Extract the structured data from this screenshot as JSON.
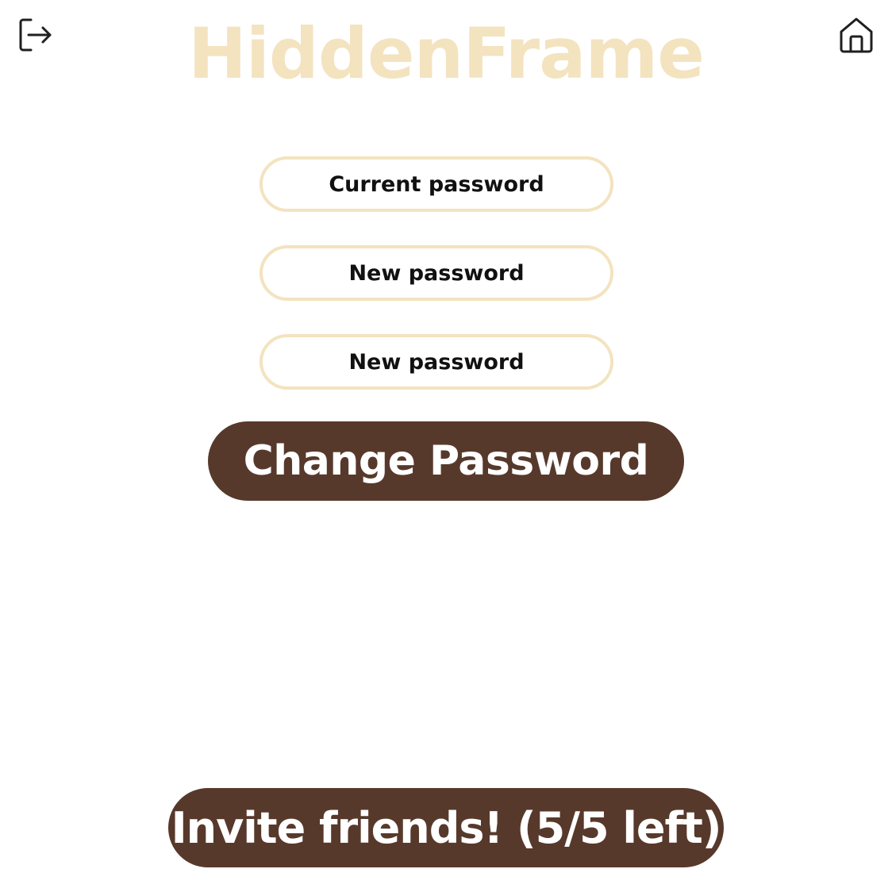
{
  "colors": {
    "brand": "#F3E3BF",
    "field_border": "#F3E3BF",
    "button_bg": "#57392B",
    "button_text": "#FFFFFF",
    "icon": "#1F1F1F"
  },
  "header": {
    "brand": "HiddenFrame",
    "left_icon": "logout-icon",
    "right_icon": "home-icon"
  },
  "form": {
    "current_password_placeholder": "Current password",
    "new_password_placeholder": "New password",
    "confirm_password_placeholder": "New password",
    "submit_label": "Change Password"
  },
  "footer": {
    "invite_label": "Invite friends! (5/5 left)"
  }
}
